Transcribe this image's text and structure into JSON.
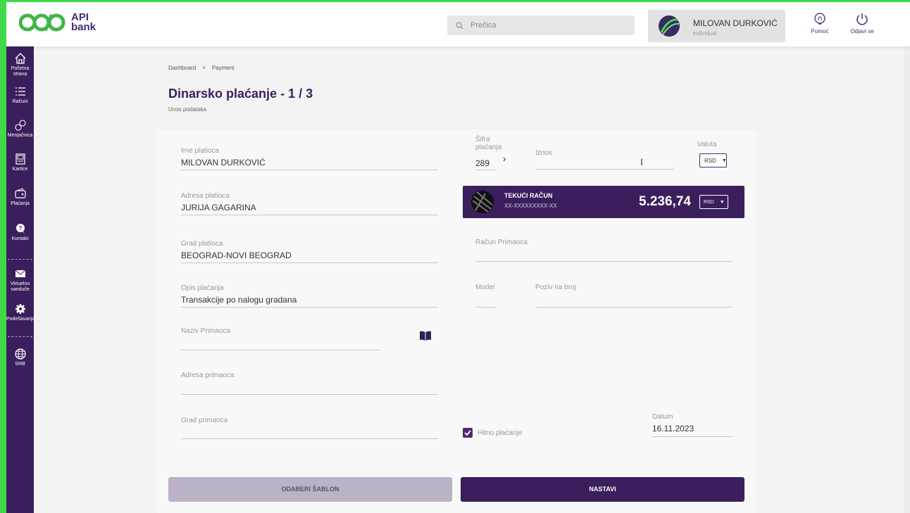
{
  "header": {
    "logo_text": "API bank",
    "logo_line1": "API",
    "logo_line2": "bank",
    "search_placeholder": "Prečica",
    "user_name": "MILOVAN DURKOVIĆ",
    "user_type": "individual",
    "help_label": "Pomoć",
    "logout_label": "Odjavi se"
  },
  "sidebar": {
    "items": [
      {
        "label": "Početna strana",
        "icon": "home-icon"
      },
      {
        "label": "Računi",
        "icon": "list-icon"
      },
      {
        "label": "Menjačnica",
        "icon": "exchange-icon"
      },
      {
        "label": "Kartice",
        "icon": "card-icon"
      },
      {
        "label": "Plaćanja",
        "icon": "wallet-icon"
      },
      {
        "label": "Kontakt",
        "icon": "chat-icon"
      },
      {
        "label": "Virtuelno sanduče",
        "icon": "mail-icon"
      },
      {
        "label": "Podešavanja",
        "icon": "gear-icon"
      },
      {
        "label": "SRB",
        "icon": "globe-icon"
      }
    ]
  },
  "breadcrumb": {
    "item1": "Dashboard",
    "separator": ">",
    "item2": "Payment"
  },
  "page": {
    "title": "Dinarsko plaćanje - 1 / 3",
    "subtitle": "Unos podataka"
  },
  "form": {
    "payer_name_label": "Ime platioca",
    "payer_name_value": "MILOVAN DURKOVIĆ",
    "payer_address_label": "Adresa platioca",
    "payer_address_value": "JURIJA GAGARINA",
    "payer_city_label": "Grad platioca",
    "payer_city_value": "BEOGRAD-NOVI BEOGRAD",
    "description_label": "Opis plaćanja",
    "description_value": "Transakcije po nalogu gradana",
    "recipient_name_label": "Naziv Primaoca",
    "recipient_address_label": "Adresa primaoca",
    "recipient_city_label": "Grad primaoca",
    "payment_code_label": "Šifra plaćanja",
    "payment_code_value": "289",
    "amount_label": "Iznos",
    "currency_label": "Valuta",
    "currency_value": "RSD",
    "recipient_account_label": "Račun Primaoca",
    "model_label": "Model",
    "reference_label": "Poziv na broj",
    "urgent_label": "Hitno plaćanje",
    "urgent_checked": true,
    "date_label": "Datum",
    "date_value": "16.11.2023"
  },
  "account": {
    "title": "TEKUĆI RAČUN",
    "number": "XX-XXXXXXXXX-XX",
    "balance": "5.236,74",
    "currency": "RSD"
  },
  "buttons": {
    "template": "ODABERI ŠABLON",
    "next": "NASTAVI"
  },
  "colors": {
    "primary": "#3a1f5c",
    "frame": "#3fd94a",
    "button_disabled": "#bbb2c6"
  }
}
